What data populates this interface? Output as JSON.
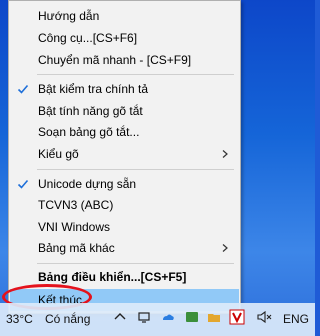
{
  "menu": {
    "items": [
      {
        "label": "Hướng dẫn",
        "checked": false,
        "submenu": false,
        "bold": false
      },
      {
        "label": "Công cụ...[CS+F6]",
        "checked": false,
        "submenu": false,
        "bold": false
      },
      {
        "label": "Chuyển mã nhanh - [CS+F9]",
        "checked": false,
        "submenu": false,
        "bold": false
      },
      {
        "label": "Bật kiểm tra chính tả",
        "checked": true,
        "submenu": false,
        "bold": false
      },
      {
        "label": "Bật tính năng gõ tắt",
        "checked": false,
        "submenu": false,
        "bold": false
      },
      {
        "label": "Soạn bảng gõ tắt...",
        "checked": false,
        "submenu": false,
        "bold": false
      },
      {
        "label": "Kiểu gõ",
        "checked": false,
        "submenu": true,
        "bold": false
      },
      {
        "label": "Unicode dựng sẵn",
        "checked": true,
        "submenu": false,
        "bold": false
      },
      {
        "label": "TCVN3 (ABC)",
        "checked": false,
        "submenu": false,
        "bold": false
      },
      {
        "label": "VNI Windows",
        "checked": false,
        "submenu": false,
        "bold": false
      },
      {
        "label": "Bảng mã khác",
        "checked": false,
        "submenu": true,
        "bold": false
      },
      {
        "label": "Bảng điều khiển...[CS+F5]",
        "checked": false,
        "submenu": false,
        "bold": true
      },
      {
        "label": "Kết thúc",
        "checked": false,
        "submenu": false,
        "bold": false,
        "highlighted": true
      }
    ]
  },
  "taskbar": {
    "temperature": "33°C",
    "weather": "Có nắng",
    "language": "ENG"
  },
  "colors": {
    "highlight": "#91c9f7",
    "check": "#1e6fd9",
    "annotation": "#e4121c"
  }
}
